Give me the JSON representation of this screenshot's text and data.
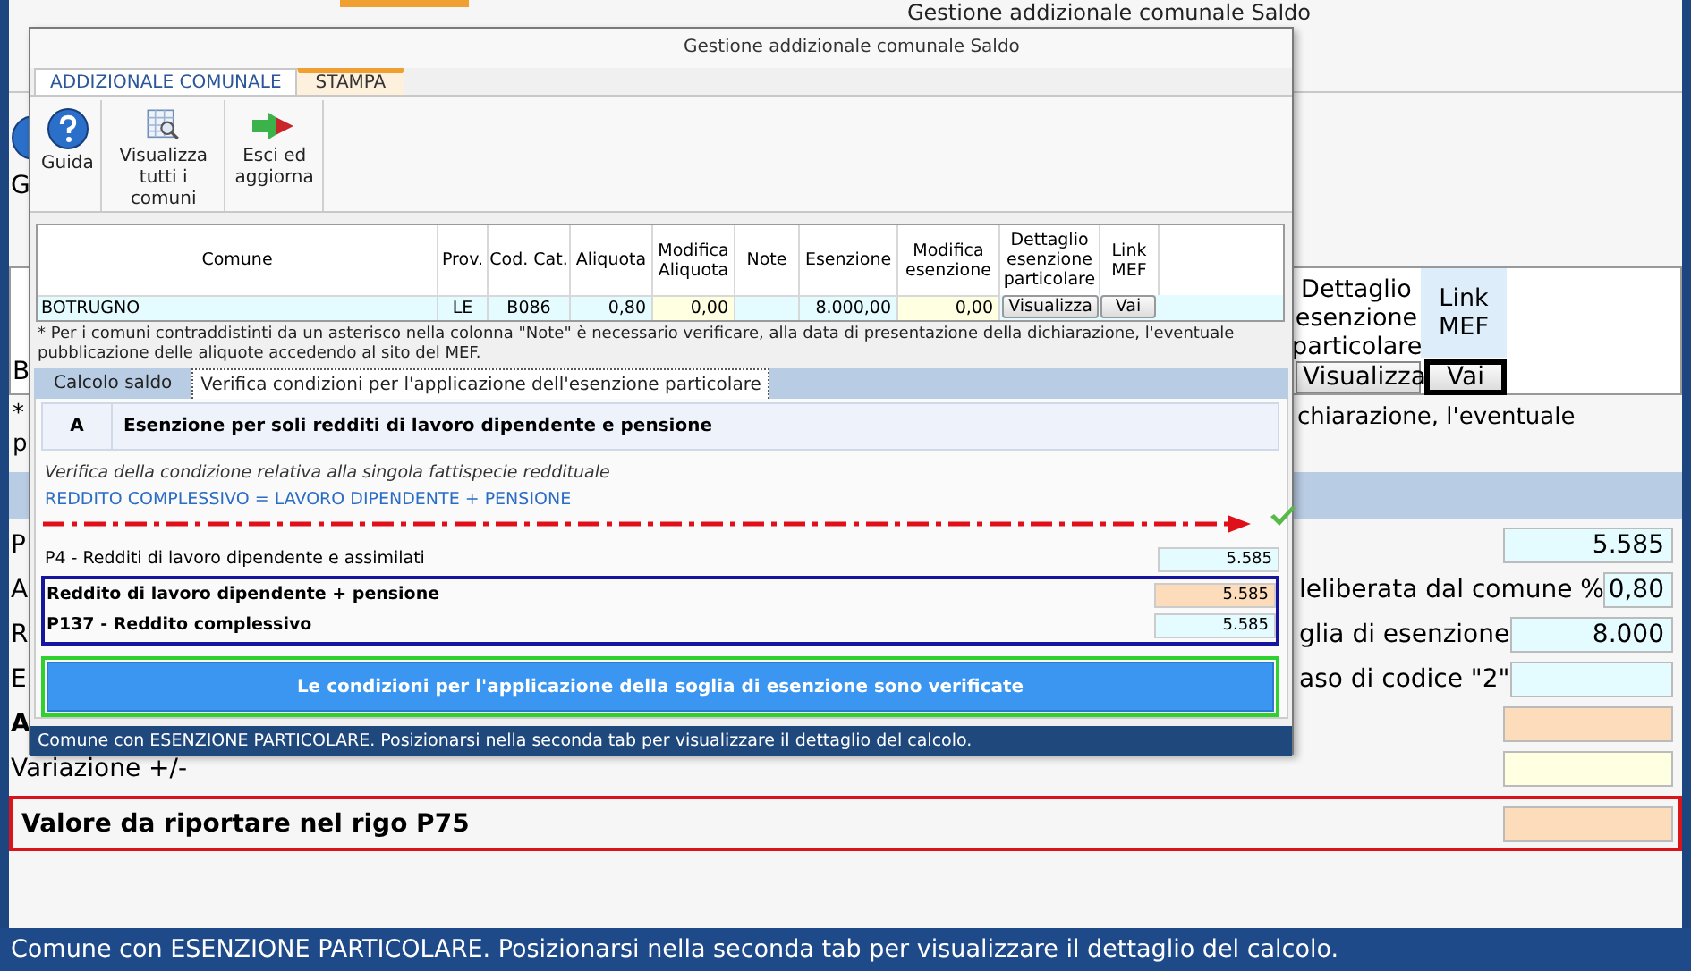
{
  "background": {
    "title": "Gestione addizionale comunale Saldo",
    "toolbar_fragment": "G",
    "table_fragment": "B",
    "columns": [
      {
        "label": "Dettaglio esenzione particolare",
        "highlighted": false
      },
      {
        "label": "Link MEF",
        "highlighted": true
      }
    ],
    "buttons": [
      {
        "label": "Visualizza",
        "focused": false
      },
      {
        "label": "Vai",
        "focused": true
      }
    ],
    "note_fragments": [
      "*",
      "p"
    ],
    "note_tail": "chiarazione, l'eventuale",
    "rows": [
      {
        "label": "P",
        "value": "5.585",
        "kind": "calc",
        "bold": false,
        "highlighted": false
      },
      {
        "label": "A",
        "tail": "leliberata dal comune %",
        "value": "0,80",
        "kind": "rate",
        "bold": false,
        "highlighted": false
      },
      {
        "label": "R",
        "tail": "glia di esenzione",
        "value": "8.000",
        "kind": "calc",
        "bold": false,
        "highlighted": false
      },
      {
        "label": "E",
        "tail": "aso di codice \"2\"",
        "kind": "calc",
        "bold": false,
        "highlighted": false
      },
      {
        "label": "A",
        "kind": "result",
        "bold": true,
        "highlighted": false
      },
      {
        "label": "Variazione +/-",
        "kind": "input",
        "bold": false,
        "highlighted": false
      },
      {
        "label": "Valore da riportare nel rigo P75",
        "kind": "result",
        "bold": true,
        "highlighted": true
      }
    ],
    "status_bar": "Comune con ESENZIONE PARTICOLARE. Posizionarsi nella seconda tab per visualizzare il dettaglio del calcolo."
  },
  "dialog": {
    "title": "Gestione addizionale comunale Saldo",
    "ribbon_tabs": [
      {
        "label": "ADDIZIONALE COMUNALE",
        "selected": true
      },
      {
        "label": "STAMPA",
        "selected": false
      }
    ],
    "toolbar": [
      {
        "label": "Guida",
        "kind": "help"
      },
      {
        "label": "Visualizza tutti i comuni",
        "kind": "grid"
      },
      {
        "label": "Esci ed aggiorna",
        "kind": "exit"
      }
    ],
    "table": {
      "columns": [
        "Comune",
        "Prov.",
        "Cod. Cat.",
        "Aliquota",
        "Modifica Aliquota",
        "Note",
        "Esenzione",
        "Modifica esenzione",
        "Dettaglio esenzione particolare",
        "Link MEF"
      ],
      "row": {
        "comune": "BOTRUGNO",
        "prov": "LE",
        "cod_cat": "B086",
        "aliquota": "0,80",
        "modifica_aliquota": "0,00",
        "esenzione": "8.000,00",
        "modifica_esenzione": "0,00",
        "buttons": [
          "Visualizza",
          "Vai"
        ]
      }
    },
    "note": "* Per i comuni contraddistinti da un asterisco nella colonna \"Note\" è necessario verificare,  alla data di presentazione della dichiarazione, l'eventuale pubblicazione delle aliquote accedendo al sito del MEF.",
    "tabs": [
      {
        "label": "Calcolo saldo",
        "selected": false
      },
      {
        "label": "Verifica condizioni per l'applicazione dell'esenzione particolare",
        "selected": true
      }
    ],
    "section": {
      "letter": "A",
      "title": "Esenzione per soli redditi di lavoro dipendente e pensione"
    },
    "hint": "Verifica della condizione relativa alla singola fattispecie reddituale",
    "formula": "REDDITO COMPLESSIVO = LAVORO DIPENDENTE + PENSIONE",
    "verified": true,
    "rows": [
      {
        "label": "P4 - Redditi di lavoro dipendente e assimilati",
        "value": "5.585",
        "kind": "calc",
        "bold": false,
        "boxed": false
      },
      {
        "label": "Reddito di lavoro dipendente + pensione",
        "value": "5.585",
        "kind": "result",
        "bold": true,
        "boxed": true
      },
      {
        "label": "P137 - Reddito complessivo",
        "value": "5.585",
        "kind": "calc",
        "bold": true,
        "boxed": true
      }
    ],
    "result_button": "Le condizioni per l'applicazione della soglia di esenzione sono verificate",
    "status_bar": "Comune con ESENZIONE PARTICOLARE. Posizionarsi nella seconda tab per visualizzare il dettaglio del calcolo."
  }
}
